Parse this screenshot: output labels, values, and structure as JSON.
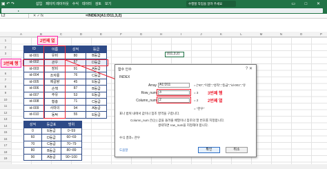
{
  "ribbon": {
    "tabs": [
      "삽입",
      "페이지 레이아웃",
      "수식",
      "데이터",
      "검토",
      "보기"
    ],
    "search": "수행할 작업을 알려 주세요",
    "quick_icons": "▣ ↶ ↷",
    "window_buttons": "▭ □ ✕"
  },
  "formula_bar": {
    "namebox": "L2",
    "fx_icon": "✕ ✓ fx",
    "formula": "=INDEX(A1:D11,3,2)"
  },
  "columns": [
    "A",
    "B",
    "C",
    "D",
    "E",
    "F",
    "G",
    "H",
    "I",
    "J",
    "K",
    "L",
    "M",
    "N",
    "O",
    "P"
  ],
  "rows": [
    "1",
    "2",
    "3",
    "4",
    "5",
    "6",
    "7",
    "8",
    "9",
    "10",
    "11",
    "12",
    "13",
    "14",
    "15",
    "16",
    "17",
    "18",
    "19",
    "20",
    "21",
    "22"
  ],
  "table1": {
    "headers": [
      "ID",
      "이름",
      "성적",
      "등급"
    ],
    "rows": [
      [
        "id-001",
        "유비",
        "80",
        "B등급"
      ],
      [
        "id-002",
        "관우",
        "67",
        "D등급"
      ],
      [
        "id-003",
        "장비",
        "91",
        "A등급"
      ],
      [
        "id-004",
        "조자룡",
        "76",
        "C등급"
      ],
      [
        "id-005",
        "제갈량",
        "45",
        "E등급"
      ],
      [
        "id-006",
        "손책",
        "87",
        "B등급"
      ],
      [
        "id-007",
        "주유",
        "53",
        "E등급"
      ],
      [
        "id-008",
        "황충",
        "71",
        "C등급"
      ],
      [
        "id-009",
        "사마의",
        "94",
        "A등급"
      ],
      [
        "id-010",
        "동탁",
        "55",
        "E등급"
      ]
    ]
  },
  "table2": {
    "headers": [
      "성적",
      "등급표",
      "범위"
    ],
    "rows": [
      [
        "0",
        "E등급",
        "0~59"
      ],
      [
        "60",
        "D등급",
        "60~69"
      ],
      [
        "70",
        "C등급",
        "70~79"
      ],
      [
        "80",
        "B등급",
        "80~89"
      ],
      [
        "90",
        "A등급",
        "90~100"
      ]
    ]
  },
  "annotations": {
    "col_label": "2번째 열",
    "row_label": "3번째 행",
    "dialog_row_label": "3번째 행",
    "dialog_col_label": "2번째 열"
  },
  "cell_ref": "(I11,3,2)",
  "dialog": {
    "title": "함수 인수",
    "close": "?  ✕",
    "function_name": "INDEX",
    "args": [
      {
        "label": "Array",
        "value": "A1:D11",
        "result": "= {\"ID\",\"이름\",\"성적\",\"등급\";\"id-001\",\"유"
      },
      {
        "label": "Row_num",
        "value": "3",
        "result": "= 3"
      },
      {
        "label": "Column_num",
        "value": "2",
        "result": "= 2"
      }
    ],
    "result_line": "= \"관우\"",
    "desc1": "표나 범위 내에서 값이나 참조 영역을 구합니다.",
    "desc2": "Column_num  은(는) 값을 돌려줄 배열이나 참조의 열 번호를 지정합니다.",
    "desc3": "생략하면 row_num을 지정해야 합니다.",
    "formula_result": "수식 결과= 관우",
    "help_link": "도움말",
    "ok": "확인",
    "cancel": "취소"
  },
  "colors": {
    "ribbon": "#217346",
    "table_header": "#2e4a87",
    "annotation": "#e22233"
  }
}
